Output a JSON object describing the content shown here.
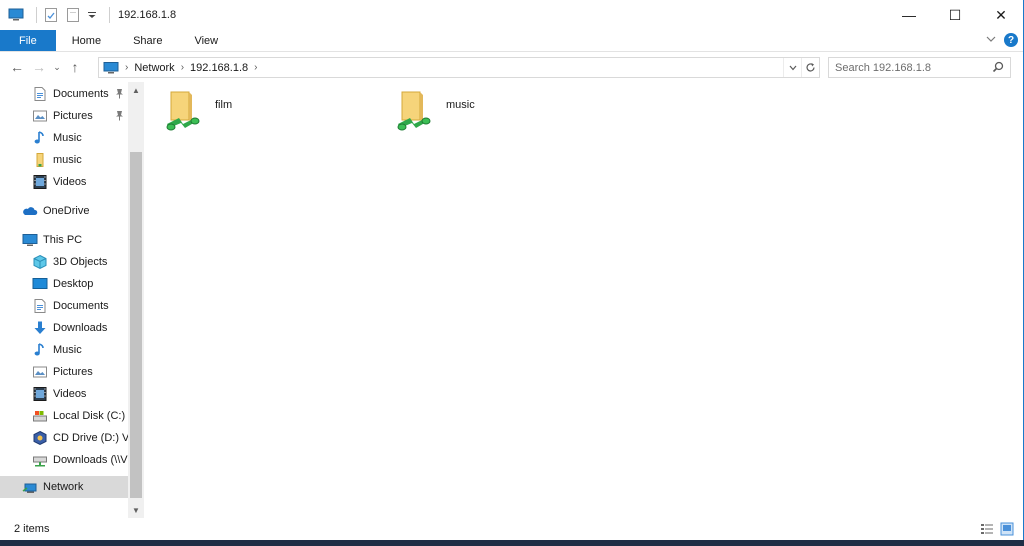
{
  "window": {
    "title": "192.168.1.8",
    "controls": {
      "minimize": "—",
      "maximize": "☐",
      "close": "✕"
    }
  },
  "ribbon": {
    "tabs": [
      {
        "label": "File",
        "active": true
      },
      {
        "label": "Home"
      },
      {
        "label": "Share"
      },
      {
        "label": "View"
      }
    ],
    "expand_icon": "chevron-down-icon",
    "help": "?"
  },
  "navigation": {
    "back": "←",
    "forward": "→",
    "recent": "⌄",
    "up": "↑",
    "breadcrumb": [
      "Network",
      "192.168.1.8"
    ],
    "search_placeholder": "Search 192.168.1.8"
  },
  "sidebar": {
    "items": [
      {
        "label": "Documents",
        "icon": "documents-icon",
        "pinned": true
      },
      {
        "label": "Pictures",
        "icon": "pictures-icon",
        "pinned": true
      },
      {
        "label": "Music",
        "icon": "music-note-icon"
      },
      {
        "label": "music",
        "icon": "folder-icon"
      },
      {
        "label": "Videos",
        "icon": "videos-icon"
      },
      {
        "label": "OneDrive",
        "icon": "onedrive-cloud-icon"
      },
      {
        "label": "This PC",
        "icon": "computer-icon"
      },
      {
        "label": "3D Objects",
        "icon": "3d-objects-icon"
      },
      {
        "label": "Desktop",
        "icon": "desktop-icon"
      },
      {
        "label": "Documents",
        "icon": "documents-icon"
      },
      {
        "label": "Downloads",
        "icon": "downloads-icon"
      },
      {
        "label": "Music",
        "icon": "music-note-icon"
      },
      {
        "label": "Pictures",
        "icon": "pictures-icon"
      },
      {
        "label": "Videos",
        "icon": "videos-icon"
      },
      {
        "label": "Local Disk (C:)",
        "icon": "local-disk-icon"
      },
      {
        "label": "CD Drive (D:) Vir",
        "icon": "cd-drive-icon"
      },
      {
        "label": "Downloads (\\\\VB",
        "icon": "network-drive-icon"
      },
      {
        "label": "Network",
        "icon": "network-icon",
        "selected": true
      }
    ]
  },
  "content": {
    "items": [
      {
        "name": "film",
        "icon": "shared-folder-icon"
      },
      {
        "name": "music",
        "icon": "shared-folder-icon"
      }
    ]
  },
  "status": {
    "count": "2 items"
  },
  "colors": {
    "accent": "#1979ca",
    "selection": "#d9d9d9",
    "folder": "#f6d47a"
  }
}
